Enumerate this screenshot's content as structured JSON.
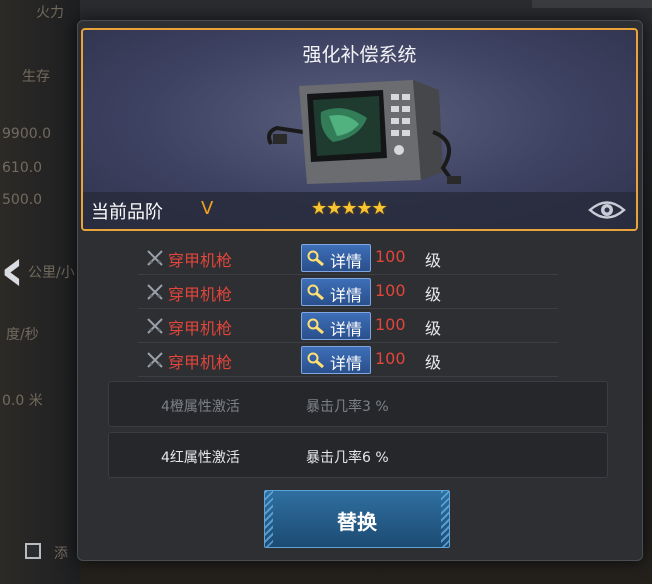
{
  "background": {
    "labels": [
      "火力",
      "生存",
      "9900.0",
      "610.0",
      "500.0",
      "公里/小",
      "度/秒",
      "0.0 米",
      "添"
    ]
  },
  "item": {
    "title": "强化补偿系统",
    "quality_label": "当前品阶",
    "quality_value": "V",
    "stars": "★★★★★",
    "star_count": 5
  },
  "attributes": [
    {
      "name": "穿甲机枪",
      "detail_label": "详情",
      "level": "100",
      "unit": "级"
    },
    {
      "name": "穿甲机枪",
      "detail_label": "详情",
      "level": "100",
      "unit": "级"
    },
    {
      "name": "穿甲机枪",
      "detail_label": "详情",
      "level": "100",
      "unit": "级"
    },
    {
      "name": "穿甲机枪",
      "detail_label": "详情",
      "level": "100",
      "unit": "级"
    }
  ],
  "activations": [
    {
      "label": "4橙属性激活",
      "value": "暴击几率3 %",
      "active": false
    },
    {
      "label": "4红属性激活",
      "value": "暴击几率6 %",
      "active": true
    }
  ],
  "replace_button": {
    "label": "替换"
  },
  "colors": {
    "card_border": "#e8a43a",
    "attr_red": "#e2453a",
    "quality_orange": "#f0a020",
    "star_gold": "#f6c531",
    "button_blue": "#2f6fa0"
  }
}
